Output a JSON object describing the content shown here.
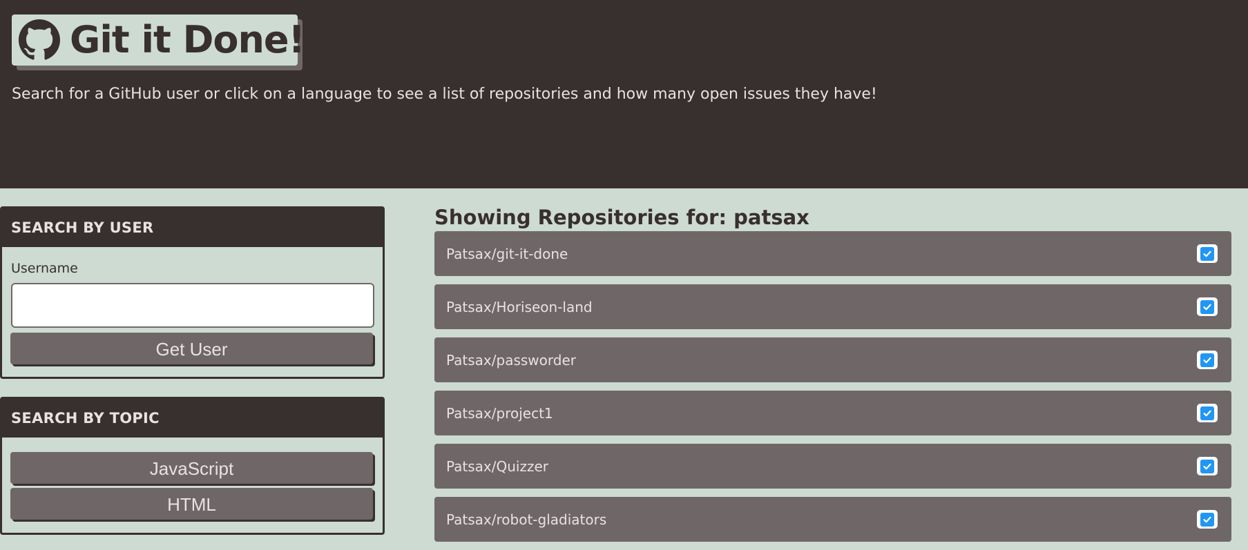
{
  "header": {
    "app_title": "Git it Done!",
    "logo_icon": "github-icon",
    "subtitle": "Search for a GitHub user or click on a language to see a list of repositories and how many open issues they have!"
  },
  "search_user": {
    "title": "SEARCH BY USER",
    "field_label": "Username",
    "input_value": "",
    "button_label": "Get User"
  },
  "search_topic": {
    "title": "SEARCH BY TOPIC",
    "buttons": [
      "JavaScript",
      "HTML"
    ]
  },
  "repos": {
    "heading": "Showing Repositories for: patsax",
    "items": [
      {
        "name": "Patsax/git-it-done",
        "status_icon": "check-square-icon"
      },
      {
        "name": "Patsax/Horiseon-land",
        "status_icon": "check-square-icon"
      },
      {
        "name": "Patsax/passworder",
        "status_icon": "check-square-icon"
      },
      {
        "name": "Patsax/project1",
        "status_icon": "check-square-icon"
      },
      {
        "name": "Patsax/Quizzer",
        "status_icon": "check-square-icon"
      },
      {
        "name": "Patsax/robot-gladiators",
        "status_icon": "check-square-icon"
      }
    ]
  },
  "colors": {
    "dark": "#382f2f",
    "mid": "#6f6767",
    "light": "#cddbd3",
    "check": "#2196f3"
  }
}
